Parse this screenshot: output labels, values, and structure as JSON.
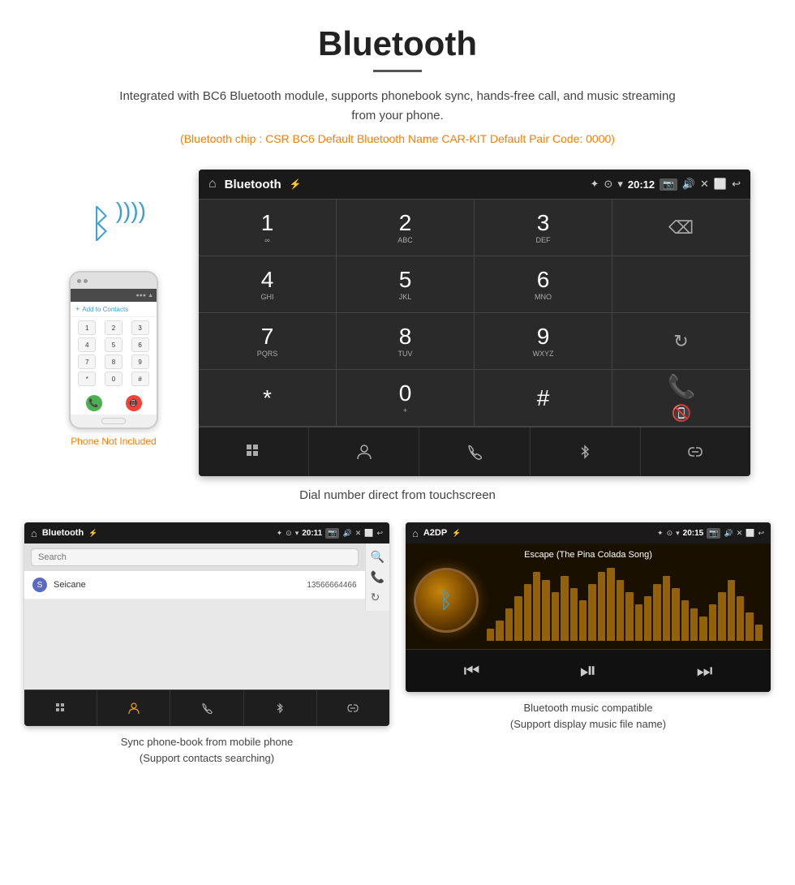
{
  "page": {
    "title": "Bluetooth",
    "description": "Integrated with BC6 Bluetooth module, supports phonebook sync, hands-free call, and music streaming from your phone.",
    "specs": "(Bluetooth chip : CSR BC6    Default Bluetooth Name CAR-KIT    Default Pair Code: 0000)",
    "phone_not_included": "Phone Not Included",
    "main_caption": "Dial number direct from touchscreen",
    "bottom_left_caption_line1": "Sync phone-book from mobile phone",
    "bottom_left_caption_line2": "(Support contacts searching)",
    "bottom_right_caption_line1": "Bluetooth music compatible",
    "bottom_right_caption_line2": "(Support display music file name)"
  },
  "car_screen": {
    "status_bar": {
      "home_icon": "⌂",
      "title": "Bluetooth",
      "usb_icon": "⚡",
      "bt_icon": "✦",
      "location_icon": "⊙",
      "wifi_icon": "▾",
      "time": "20:12",
      "camera_icon": "📷",
      "volume_icon": "🔊",
      "close_icon": "✕",
      "window_icon": "⬜",
      "back_icon": "↩"
    },
    "dialpad": {
      "keys": [
        {
          "num": "1",
          "letters": "∞",
          "col": 0
        },
        {
          "num": "2",
          "letters": "ABC",
          "col": 1
        },
        {
          "num": "3",
          "letters": "DEF",
          "col": 2
        },
        {
          "num": "",
          "letters": "",
          "col": 3,
          "special": "backspace"
        },
        {
          "num": "4",
          "letters": "GHI",
          "col": 0
        },
        {
          "num": "5",
          "letters": "JKL",
          "col": 1
        },
        {
          "num": "6",
          "letters": "MNO",
          "col": 2
        },
        {
          "num": "",
          "letters": "",
          "col": 3,
          "special": "empty"
        },
        {
          "num": "7",
          "letters": "PQRS",
          "col": 0
        },
        {
          "num": "8",
          "letters": "TUV",
          "col": 1
        },
        {
          "num": "9",
          "letters": "WXYZ",
          "col": 2
        },
        {
          "num": "",
          "letters": "",
          "col": 3,
          "special": "refresh"
        },
        {
          "num": "*",
          "letters": "",
          "col": 0
        },
        {
          "num": "0",
          "letters": "+",
          "col": 1
        },
        {
          "num": "#",
          "letters": "",
          "col": 2
        },
        {
          "num": "",
          "letters": "",
          "col": 3,
          "special": "call-end"
        }
      ],
      "bottom_icons": [
        "grid",
        "person",
        "phone",
        "bluetooth",
        "link"
      ]
    }
  },
  "phonebook_screen": {
    "status_bar": {
      "home": "⌂",
      "title": "Bluetooth",
      "usb": "⚡",
      "bt": "✦",
      "loc": "⊙",
      "wifi": "▾",
      "time": "20:11",
      "camera": "📷",
      "volume": "🔊",
      "close": "✕",
      "window": "⬜",
      "back": "↩"
    },
    "search_placeholder": "Search",
    "contacts": [
      {
        "letter": "S",
        "name": "Seicane",
        "phone": "13566664466"
      }
    ],
    "bottom_icons": [
      "grid",
      "person",
      "phone",
      "bluetooth",
      "link"
    ],
    "side_icons": [
      "search",
      "phone",
      "refresh"
    ]
  },
  "music_screen": {
    "status_bar": {
      "home": "⌂",
      "title": "A2DP",
      "usb": "⚡",
      "bt": "✦",
      "loc": "⊙",
      "wifi": "▾",
      "time": "20:15",
      "camera": "📷",
      "volume": "🔊",
      "close": "✕",
      "window": "⬜",
      "back": "↩"
    },
    "track_name": "Escape (The Pina Colada Song)",
    "viz_bars": [
      15,
      25,
      40,
      55,
      70,
      85,
      75,
      60,
      80,
      65,
      50,
      70,
      85,
      90,
      75,
      60,
      45,
      55,
      70,
      80,
      65,
      50,
      40,
      30,
      45,
      60,
      75,
      55,
      35,
      20
    ],
    "controls": {
      "prev": "⏮",
      "play_pause": "⏯",
      "next": "⏭"
    }
  },
  "colors": {
    "orange": "#f77f00",
    "blue": "#3a9fd5",
    "green": "#4caf50",
    "red": "#f44336",
    "dark_bg": "#2a2a2a",
    "status_bg": "#1a1a1a"
  }
}
